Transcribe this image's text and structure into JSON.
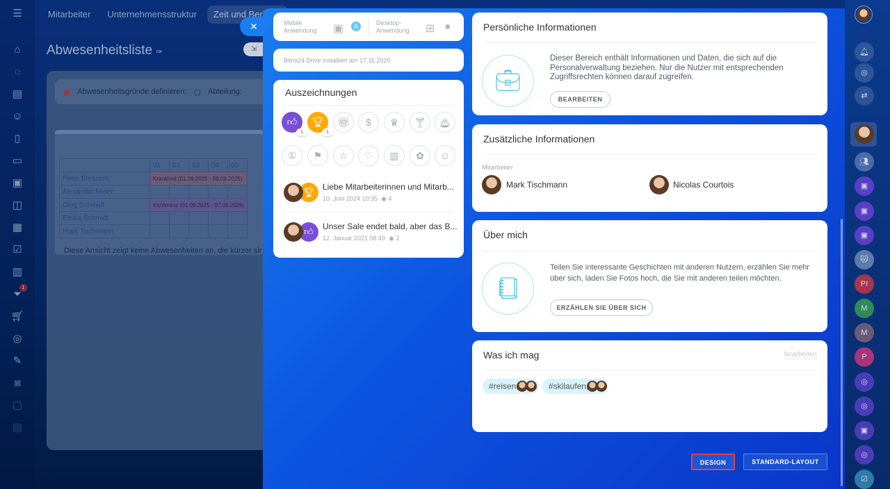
{
  "topnav": {
    "items": [
      "Mitarbeiter",
      "Unternehmensstruktur",
      "Zeit und Berichte"
    ]
  },
  "background": {
    "title": "Abwesenheitsliste",
    "toolbar": {
      "reasons_label": "Abwesenheitsgründe definieren:",
      "department_label": "Abteilung:"
    },
    "days": [
      "01",
      "02",
      "03",
      "04",
      "05"
    ],
    "rows": [
      {
        "name": "Peter Bressem",
        "bar": "Krankheit (01.09.2025 - 08.09.2025)"
      },
      {
        "name": "Alexander Meier",
        "bar": ""
      },
      {
        "name": "Oleg Schmidt",
        "bar": "Konferenz (01.09.2025 - 07.09.2025)"
      },
      {
        "name": "Emilia Schmidt",
        "bar": ""
      },
      {
        "name": "Mark Tischmann",
        "bar": ""
      }
    ],
    "note": "Diese Ansicht zeigt keine Abwesenheiten an, die kürzer sind",
    "badge_count": "1"
  },
  "apps": {
    "mobile": "Mobile Anwendung",
    "desktop": "Desktop-Anwendung"
  },
  "drive": "Bitrix24 Drive installiert am 17.11.2020",
  "awards": {
    "title": "Auszeichnungen",
    "counts": [
      "1",
      "1"
    ],
    "posts": [
      {
        "title": "Liebe Mitarbeiterinnen und Mitarb...",
        "date": "10. Juni 2024 10:35",
        "views": "4"
      },
      {
        "title": "Unser Sale endet bald, aber das B...",
        "date": "12. Januar 2021 08:49",
        "views": "2"
      }
    ]
  },
  "personal": {
    "title": "Persönliche Informationen",
    "text": "Dieser Bereich enthält Informationen und Daten, die sich auf die Personalverwaltung beziehen. Nur die Nutzer mit entsprechenden Zugriffsrechten können darauf zugreifen.",
    "button": "BEARBEITEN"
  },
  "additional": {
    "title": "Zusätzliche Informationen",
    "label": "Mitarbeiter",
    "people": [
      "Mark Tischmann",
      "Nicolas Courtois"
    ]
  },
  "about": {
    "title": "Über mich",
    "text": "Teilen Sie interessante Geschichten mit anderen Nutzern, erzählen Sie mehr über sich, laden Sie Fotos hoch, die Sie mit anderen teilen möchten.",
    "button": "ERZÄHLEN SIE ÜBER SICH"
  },
  "likes": {
    "title": "Was ich mag",
    "edit": "bearbeiten",
    "tags": [
      "#reisen,",
      "#skilaufen,"
    ]
  },
  "footer": {
    "design": "DESIGN",
    "standard": "STANDARD-LAYOUT"
  },
  "rail": {
    "initials": [
      "PI",
      "M",
      "M",
      "P"
    ]
  },
  "colors": {
    "accent": "#1a7df0",
    "highlight": "#e5433a",
    "award_purple": "#7a4fd6",
    "award_orange": "#ffa900"
  }
}
